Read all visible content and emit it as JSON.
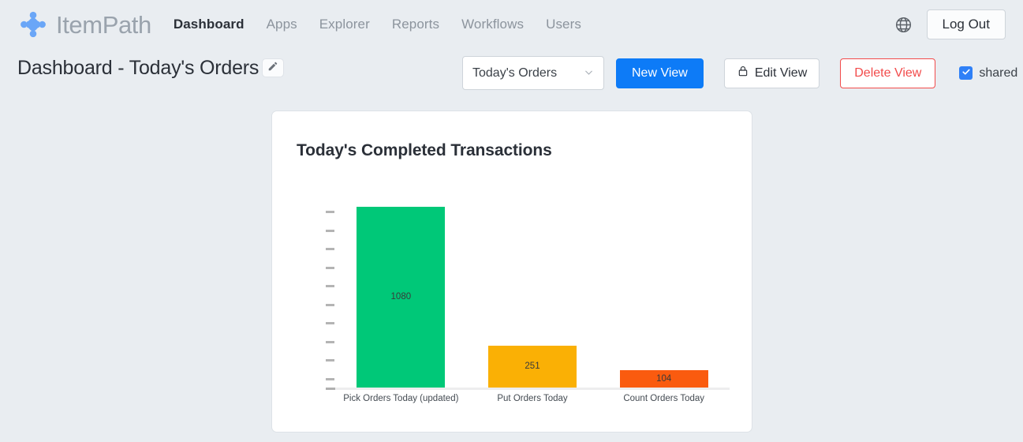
{
  "header": {
    "brand_name": "ItemPath",
    "brand_icon": "itempath-dots-logo",
    "nav": [
      {
        "label": "Dashboard",
        "active": true
      },
      {
        "label": "Apps",
        "active": false
      },
      {
        "label": "Explorer",
        "active": false
      },
      {
        "label": "Reports",
        "active": false
      },
      {
        "label": "Workflows",
        "active": false
      },
      {
        "label": "Users",
        "active": false
      }
    ],
    "globe_icon": "globe-icon",
    "logout_label": "Log Out"
  },
  "subbar": {
    "page_title": "Dashboard - Today's Orders",
    "edit_title_icon": "pencil-icon",
    "view_select": {
      "value": "Today's Orders",
      "caret_icon": "chevron-down-icon"
    },
    "new_view_label": "New View",
    "edit_view_label": "Edit View",
    "edit_view_icon": "lock-icon",
    "delete_view_label": "Delete View",
    "shared_label": "shared",
    "shared_checked": true,
    "check_icon": "check-icon"
  },
  "card": {
    "title": "Today's Completed Transactions"
  },
  "colors": {
    "accent_blue": "#0d7bf7",
    "danger_red": "#f24b4b",
    "bar_green": "#00c878",
    "bar_amber": "#fab005",
    "bar_orange": "#fa5b0f"
  },
  "chart_data": {
    "type": "bar",
    "title": "Today's Completed Transactions",
    "xlabel": "",
    "ylabel": "",
    "grid": false,
    "legend": "none",
    "ylim": [
      0,
      1200
    ],
    "y_tick_count": 10,
    "y_tick_labels": [],
    "categories": [
      "Pick Orders Today (updated)",
      "Put Orders Today",
      "Count Orders Today"
    ],
    "values": [
      1080,
      251,
      104
    ],
    "value_labels": [
      "1080",
      "251",
      "104"
    ],
    "bar_colors": [
      "#00c878",
      "#fab005",
      "#fa5b0f"
    ]
  }
}
